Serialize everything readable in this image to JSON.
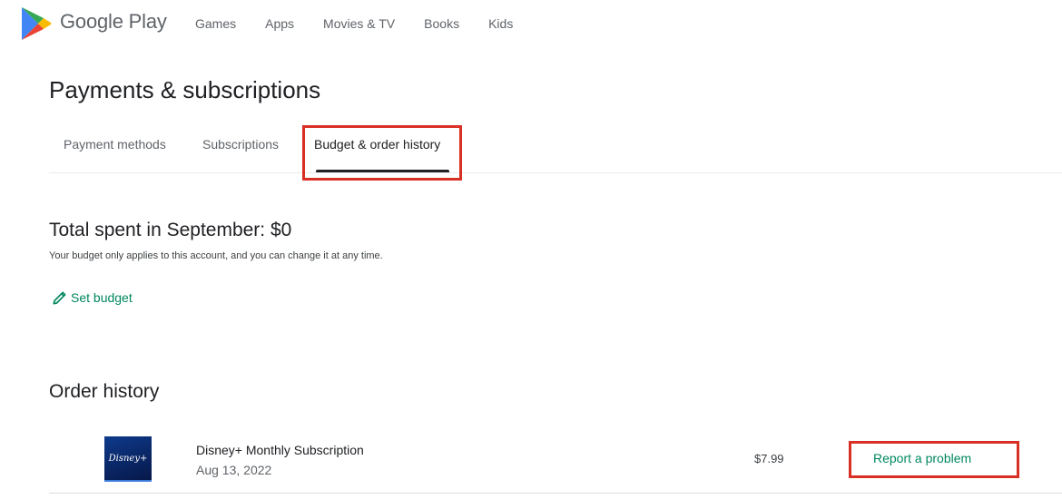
{
  "brand": {
    "name": "Google Play",
    "icon": "google-play-logo-icon",
    "colors": {
      "green": "#01875f",
      "blue": "#4285f4",
      "red": "#ea4335",
      "yellow": "#fbbc04",
      "highlight": "#d93025"
    }
  },
  "nav": {
    "items": [
      {
        "label": "Games"
      },
      {
        "label": "Apps"
      },
      {
        "label": "Movies & TV"
      },
      {
        "label": "Books"
      },
      {
        "label": "Kids"
      }
    ]
  },
  "page": {
    "title": "Payments & subscriptions"
  },
  "tabs": [
    {
      "label": "Payment methods",
      "active": false
    },
    {
      "label": "Subscriptions",
      "active": false
    },
    {
      "label": "Budget & order history",
      "active": true
    }
  ],
  "budget": {
    "title": "Total spent in September: $0",
    "subtitle": "Your budget only applies to this account, and you can change it at any time.",
    "set_budget_label": "Set budget",
    "set_budget_icon": "pencil-icon"
  },
  "order_history": {
    "title": "Order history",
    "orders": [
      {
        "thumbnail_text": "Disney+",
        "name": "Disney+ Monthly Subscription",
        "date": "Aug 13, 2022",
        "price": "$7.99",
        "action_label": "Report a problem"
      }
    ]
  }
}
